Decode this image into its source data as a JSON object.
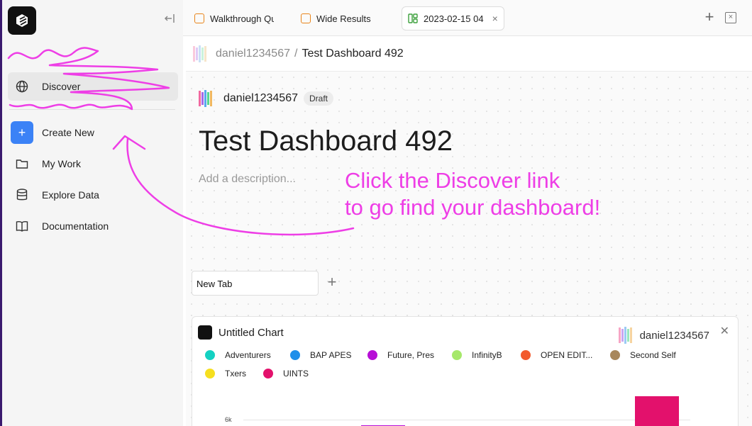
{
  "sidebar": {
    "items": [
      {
        "label": "Discover",
        "icon": "globe-icon",
        "active": true
      },
      {
        "label": "Create New",
        "icon": "plus-icon"
      },
      {
        "label": "My Work",
        "icon": "folder-icon"
      },
      {
        "label": "Explore Data",
        "icon": "database-icon"
      },
      {
        "label": "Documentation",
        "icon": "book-icon"
      }
    ]
  },
  "tabs": [
    {
      "label": "Walkthrough Qu",
      "active": false
    },
    {
      "label": "Wide Results",
      "active": false
    },
    {
      "label": "2023-02-15 04",
      "active": true
    }
  ],
  "breadcrumb": {
    "user": "daniel1234567",
    "separator": "/",
    "title": "Test Dashboard 492"
  },
  "dashboard": {
    "owner": "daniel1234567",
    "status_badge": "Draft",
    "title": "Test Dashboard 492",
    "description_placeholder": "Add a description...",
    "tabs": [
      {
        "label": "New Tab"
      }
    ]
  },
  "chart": {
    "title": "Untitled Chart",
    "owner": "daniel1234567",
    "legend": [
      {
        "name": "Adventurers",
        "color": "#14d1c2"
      },
      {
        "name": "BAP APES",
        "color": "#1e8fea"
      },
      {
        "name": "Future, Pres",
        "color": "#b70fd6"
      },
      {
        "name": "InfinityB",
        "color": "#a6e86a"
      },
      {
        "name": "OPEN EDIT...",
        "color": "#f25a2d"
      },
      {
        "name": "Second Self",
        "color": "#a8875c"
      },
      {
        "name": "Txers",
        "color": "#f6df1f"
      },
      {
        "name": "UINTS",
        "color": "#e3116c"
      }
    ],
    "y_tick": "6k"
  },
  "annotation": {
    "line1": "Click the Discover link",
    "line2": "to go find your dashboard!",
    "color": "#ee3ee6"
  }
}
